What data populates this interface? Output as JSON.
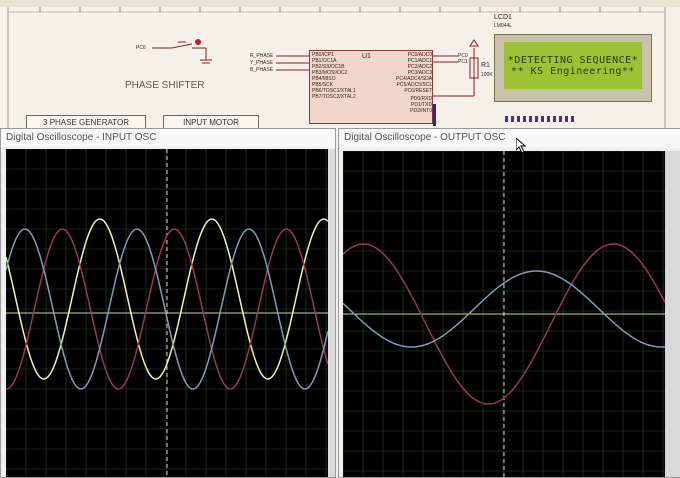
{
  "schematic": {
    "toolbar_label": "",
    "phase_shifter_label": "PHASE SHIFTER",
    "pc6_label": "PC6",
    "phase_r": "R_PHASE",
    "phase_y": "Y_PHASE",
    "phase_b": "B_PHASE",
    "ic_name": "U1",
    "ic_pins_left": [
      "PB0/ICP1",
      "PB1/OC1A",
      "PB2/SS/OC1B",
      "PB3/MOSI/OC2",
      "PB4/MISO",
      "PB5/SCK",
      "PB6/TOSC1/XTAL1",
      "PB7/TOSC2/XTAL2"
    ],
    "ic_pins_right": [
      "PC0/ADC0",
      "PC1/ADC1",
      "PC2/ADC2",
      "PC3/ADC3",
      "PC4/ADC4/SDA",
      "PC5/ADC5/SCL",
      "PC6/RESET",
      "PD0/RXD",
      "PD1/TXD",
      "PD2/INT0"
    ],
    "pc0": "PC0",
    "pc1": "PC1",
    "r1_label": "R1",
    "r1_value": "100K",
    "lcd_name": "LCD1",
    "lcd_model": "LM044L",
    "lcd_line1": "*DETECTING SEQUENCE*",
    "lcd_line2": "** KS Engineering**",
    "generator_button": "3 PHASE GENERATOR",
    "motor_button": "INPUT MOTOR"
  },
  "input_osc": {
    "title": "Digital Oscilloscope - INPUT OSC"
  },
  "output_osc": {
    "title": "Digital Oscilloscope - OUTPUT OSC"
  },
  "colors": {
    "trace_yellow": "#f4f2a6",
    "trace_magenta": "#9a3556",
    "trace_blue": "#7f9cb7",
    "center_line": "#c9d98f",
    "grid": "#2a4a2a"
  }
}
